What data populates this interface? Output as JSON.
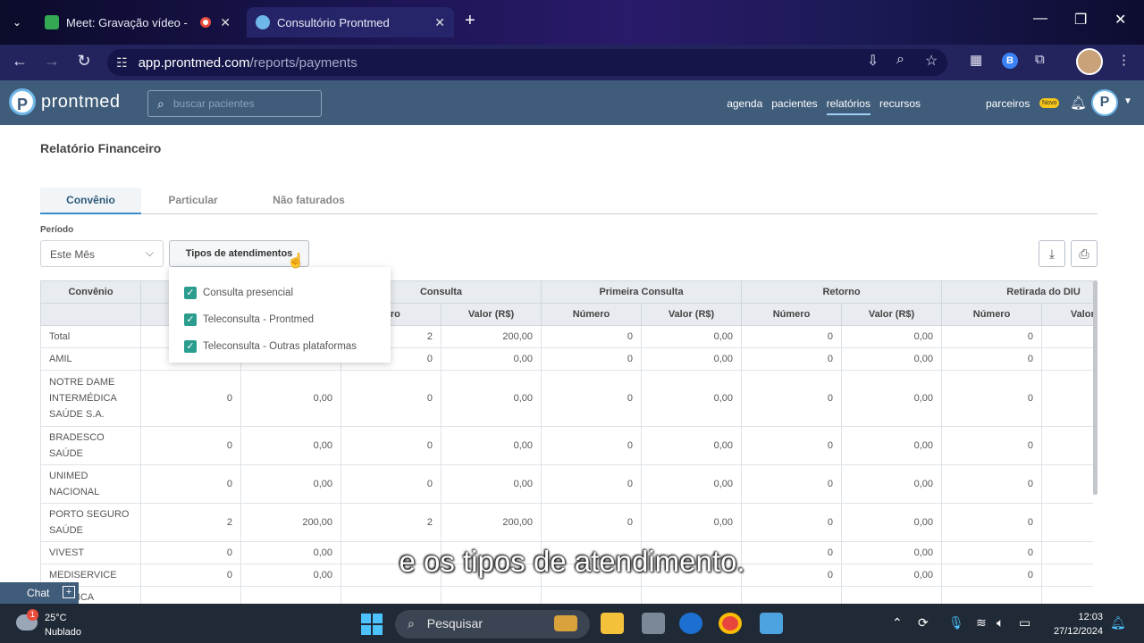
{
  "browser": {
    "tabs": [
      {
        "title": "Meet: Gravação vídeo - Co",
        "active": false
      },
      {
        "title": "Consultório Prontmed",
        "active": true
      }
    ],
    "url_host": "app.prontmed.com",
    "url_path": "/reports/payments",
    "profile_letter": "B"
  },
  "app": {
    "logo_letter": "P",
    "brand": "prontmed",
    "search_placeholder": "buscar pacientes",
    "nav": [
      {
        "label": "agenda",
        "active": false
      },
      {
        "label": "pacientes",
        "active": false
      },
      {
        "label": "relatórios",
        "active": true
      },
      {
        "label": "recursos",
        "active": false
      }
    ],
    "parceiros": "parceiros",
    "novo_badge": "Novo",
    "avatar_letter": "P"
  },
  "page": {
    "title": "Relatório Financeiro",
    "tabs": [
      "Convênio",
      "Particular",
      "Não faturados"
    ],
    "periodo_label": "Período",
    "periodo_value": "Este Mês",
    "tipos_button": "Tipos de atendimentos",
    "dropdown_options": [
      {
        "label": "Consulta presencial",
        "checked": true
      },
      {
        "label": "Teleconsulta - Prontmed",
        "checked": true
      },
      {
        "label": "Teleconsulta - Outras plataformas",
        "checked": true
      }
    ]
  },
  "table": {
    "group_headers": [
      "Convênio",
      "",
      "Consulta",
      "Primeira Consulta",
      "Retorno",
      "Retirada do DIU"
    ],
    "sub_headers": [
      "",
      "",
      "",
      "Número",
      "Valor (R$)",
      "Número",
      "Valor (R$)",
      "Número",
      "Valor (R$)",
      "Número",
      "Valor (R$)"
    ],
    "rows": [
      {
        "name": "Total",
        "cells": [
          "",
          "",
          "2",
          "200,00",
          "0",
          "0,00",
          "0",
          "0,00",
          "0",
          ""
        ]
      },
      {
        "name": "AMIL",
        "cells": [
          "",
          "",
          "0",
          "0,00",
          "0",
          "0,00",
          "0",
          "0,00",
          "0",
          ""
        ]
      },
      {
        "name": "NOTRE DAME INTERMÉDICA SAÚDE S.A.",
        "cells": [
          "0",
          "0,00",
          "0",
          "0,00",
          "0",
          "0,00",
          "0",
          "0,00",
          "0",
          ""
        ]
      },
      {
        "name": "BRADESCO SAÚDE",
        "cells": [
          "0",
          "0,00",
          "0",
          "0,00",
          "0",
          "0,00",
          "0",
          "0,00",
          "0",
          ""
        ]
      },
      {
        "name": "UNIMED NACIONAL",
        "cells": [
          "0",
          "0,00",
          "0",
          "0,00",
          "0",
          "0,00",
          "0",
          "0,00",
          "0",
          ""
        ]
      },
      {
        "name": "PORTO SEGURO SAÚDE",
        "cells": [
          "2",
          "200,00",
          "2",
          "200,00",
          "0",
          "0,00",
          "0",
          "0,00",
          "0",
          ""
        ]
      },
      {
        "name": "VIVEST",
        "cells": [
          "0",
          "0,00",
          "",
          "",
          "",
          "",
          "0",
          "0,00",
          "0",
          ""
        ]
      },
      {
        "name": "MEDISERVICE",
        "cells": [
          "0",
          "0,00",
          "",
          "",
          "",
          "",
          "0",
          "0,00",
          "0",
          ""
        ]
      },
      {
        "name": "AMERICA",
        "cells": [
          "",
          "",
          "",
          "",
          "",
          "",
          "",
          "",
          "",
          ""
        ]
      }
    ]
  },
  "subtitle": "e os tipos de atendimento.",
  "chat": {
    "label": "Chat"
  },
  "taskbar": {
    "temp": "25°C",
    "weather": "Nublado",
    "weather_badge": "1",
    "search": "Pesquisar",
    "time": "12:03",
    "date": "27/12/2024"
  }
}
